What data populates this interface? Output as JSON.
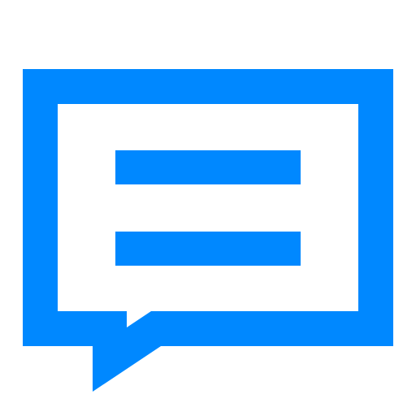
{
  "icon": {
    "name": "chat-message-icon",
    "accent_color": "#0088FF",
    "background_color": "#FFFFFF",
    "text_lines": 2
  }
}
